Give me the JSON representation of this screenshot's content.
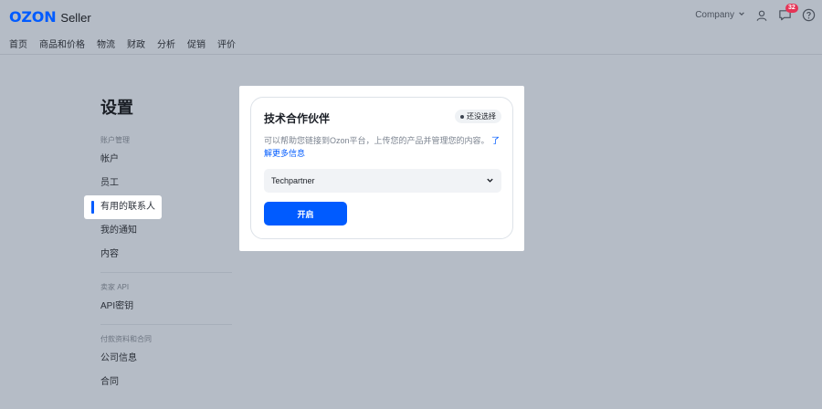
{
  "header": {
    "logo": "OZON",
    "logo_suffix": "Seller",
    "nav": [
      "首页",
      "商品和价格",
      "物流",
      "财政",
      "分析",
      "促销",
      "评价"
    ],
    "company_label": "Company",
    "notifications_count": "32"
  },
  "settings": {
    "title": "设置",
    "groups": [
      {
        "label": "账户管理",
        "items": [
          "帐户",
          "员工",
          "有用的联系人",
          "我的通知",
          "内容"
        ]
      },
      {
        "label": "卖家 API",
        "items": [
          "API密钥"
        ]
      },
      {
        "label": "付款资料和合同",
        "items": [
          "公司信息",
          "合同"
        ]
      }
    ],
    "active_item": "有用的联系人"
  },
  "partner_card": {
    "title": "技术合作伙伴",
    "chip_label": "还没选择",
    "description": "可以帮助您链接到Ozon平台，上传您的产品并管理您的内容。",
    "link_text": "了解更多信息",
    "select_value": "Techpartner",
    "enable_button": "开启"
  },
  "colors": {
    "accent": "#005bff",
    "overlay_bg": "#b5bcc6",
    "badge": "#e53456"
  },
  "icons": [
    "chevron-down-icon",
    "user-icon",
    "chat-icon",
    "help-icon",
    "dot-icon"
  ]
}
